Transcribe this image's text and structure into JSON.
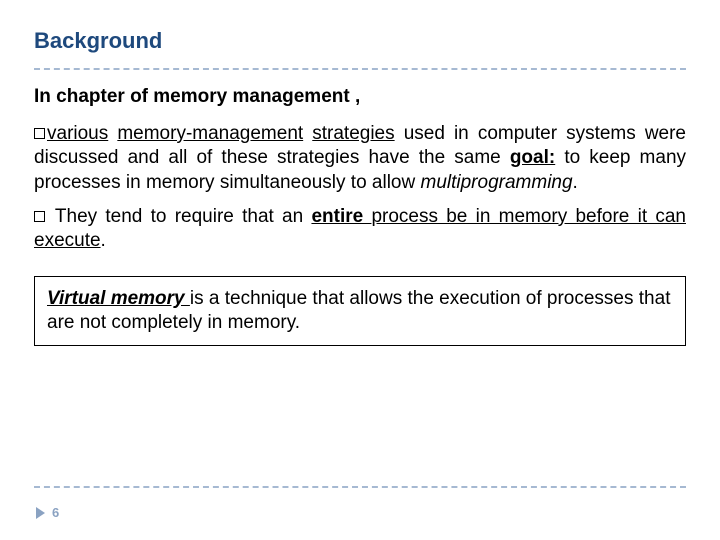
{
  "title": "Background",
  "subheading": "In chapter of memory management ,",
  "para1": {
    "lead_u": "various",
    "mm_u": "memory-management",
    "strat_u": "strategies",
    "t1": " used in computer systems were discussed  and all of these strategies have the same ",
    "goal_bu": "goal:",
    "t2": " to keep many processes in memory simultaneously to allow ",
    "mp_i": "multiprogramming",
    "t3": "."
  },
  "para2": {
    "t1": "They tend to require that an ",
    "entire_bu": "entire ",
    "t2_u": "process be in memory before it can execute",
    "t3": "."
  },
  "callout": {
    "vm_biu": "Virtual memory ",
    "rest": "is a technique that allows the execution of processes that are not completely in memory."
  },
  "page_number": "6"
}
